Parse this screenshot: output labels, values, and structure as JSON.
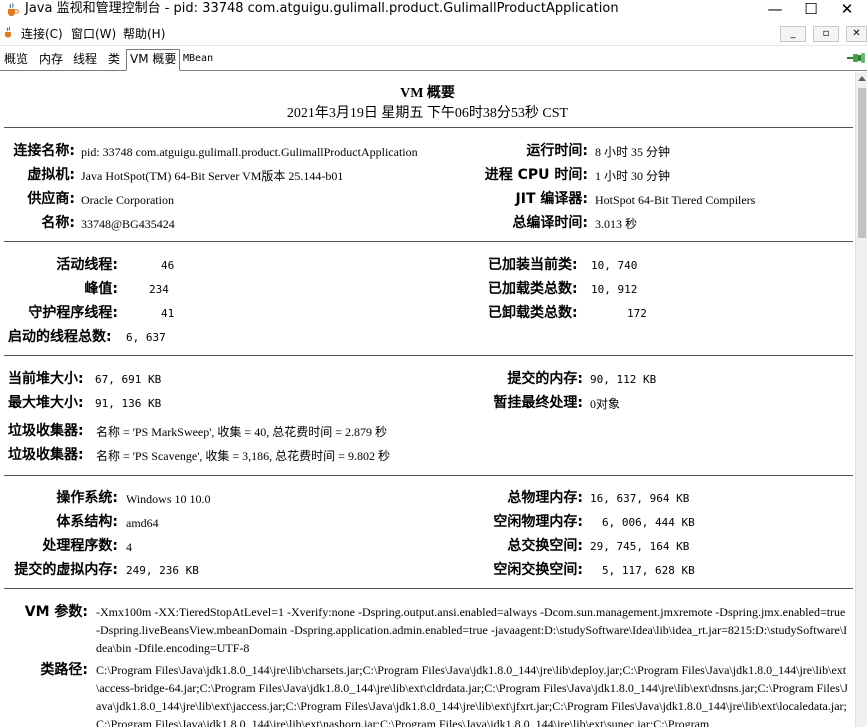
{
  "window": {
    "title": "Java 监视和管理控制台 - pid: 33748 com.atguigu.gulimall.product.GulimallProductApplication",
    "minimize": "—",
    "maximize": "☐",
    "close": "✕"
  },
  "menu": {
    "items": [
      "连接(C)",
      "窗口(W)",
      "帮助(H)"
    ],
    "mdi_buttons": [
      "_",
      "▫",
      "✕"
    ]
  },
  "tabs": [
    "概览",
    "内存",
    "线程",
    "类",
    "VM 概要",
    "MBean"
  ],
  "vm": {
    "title": "VM 概要",
    "datetime": "2021年3月19日 星期五 下午06时38分53秒 CST",
    "section1": {
      "rows_left": [
        {
          "label": "连接名称:",
          "value": "pid: 33748 com.atguigu.gulimall.product.GulimallProductApplication"
        },
        {
          "label": "虚拟机:",
          "value": "Java HotSpot(TM) 64-Bit Server VM版本 25.144-b01"
        },
        {
          "label": "供应商:",
          "value": "Oracle Corporation"
        },
        {
          "label": "名称:",
          "value": "33748@BG435424"
        }
      ],
      "rows_right": [
        {
          "label": "运行时间:",
          "value": "8 小时 35 分钟"
        },
        {
          "label": "进程 CPU 时间:",
          "value": "1 小时 30 分钟"
        },
        {
          "label": "JIT 编译器:",
          "value": "HotSpot 64-Bit Tiered Compilers"
        },
        {
          "label": "总编译时间:",
          "value": "3.013 秒"
        }
      ]
    },
    "section2": {
      "rows_left": [
        {
          "label": "活动线程:",
          "value": "46"
        },
        {
          "label": "峰值:",
          "value": "234"
        },
        {
          "label": "守护程序线程:",
          "value": "41"
        },
        {
          "label": "启动的线程总数:",
          "value": "6, 637"
        }
      ],
      "rows_right": [
        {
          "label": "已加装当前类:",
          "value": "10, 740"
        },
        {
          "label": "已加载类总数:",
          "value": "10, 912"
        },
        {
          "label": "已卸载类总数:",
          "value": "172"
        }
      ]
    },
    "section3": {
      "rows_left": [
        {
          "label": "当前堆大小:",
          "value": "67, 691 KB"
        },
        {
          "label": "最大堆大小:",
          "value": "91, 136 KB"
        }
      ],
      "rows_right": [
        {
          "label": "提交的内存:",
          "value": "90, 112 KB"
        },
        {
          "label": "暂挂最终处理:",
          "value": "0对象"
        }
      ],
      "gc": [
        {
          "label": "垃圾收集器:",
          "value": "名称 = 'PS MarkSweep', 收集 = 40, 总花费时间 = 2.879 秒"
        },
        {
          "label": "垃圾收集器:",
          "value": "名称 = 'PS Scavenge', 收集 = 3,186, 总花费时间 = 9.802 秒"
        }
      ]
    },
    "section4": {
      "rows_left": [
        {
          "label": "操作系统:",
          "value": "Windows 10 10.0"
        },
        {
          "label": "体系结构:",
          "value": "amd64"
        },
        {
          "label": "处理程序数:",
          "value": "4"
        },
        {
          "label": "提交的虚拟内存:",
          "value": "249, 236 KB"
        }
      ],
      "rows_right": [
        {
          "label": "总物理内存:",
          "value": "16, 637, 964 KB"
        },
        {
          "label": "空闲物理内存:",
          "value": "6, 006, 444 KB"
        },
        {
          "label": "总交换空间:",
          "value": "29, 745, 164 KB"
        },
        {
          "label": "空闲交换空间:",
          "value": "5, 117, 628 KB"
        }
      ]
    },
    "section5": {
      "vm_args_label": "VM 参数:",
      "vm_args": "-Xmx100m -XX:TieredStopAtLevel=1 -Xverify:none -Dspring.output.ansi.enabled=always -Dcom.sun.management.jmxremote -Dspring.jmx.enabled=true -Dspring.liveBeansView.mbeanDomain -Dspring.application.admin.enabled=true -javaagent:D:\\studySoftware\\Idea\\lib\\idea_rt.jar=8215:D:\\studySoftware\\Idea\\bin -Dfile.encoding=UTF-8",
      "classpath_label": "类路径:",
      "classpath": "C:\\Program Files\\Java\\jdk1.8.0_144\\jre\\lib\\charsets.jar;C:\\Program Files\\Java\\jdk1.8.0_144\\jre\\lib\\deploy.jar;C:\\Program Files\\Java\\jdk1.8.0_144\\jre\\lib\\ext\\access-bridge-64.jar;C:\\Program Files\\Java\\jdk1.8.0_144\\jre\\lib\\ext\\cldrdata.jar;C:\\Program Files\\Java\\jdk1.8.0_144\\jre\\lib\\ext\\dnsns.jar;C:\\Program Files\\Java\\jdk1.8.0_144\\jre\\lib\\ext\\jaccess.jar;C:\\Program Files\\Java\\jdk1.8.0_144\\jre\\lib\\ext\\jfxrt.jar;C:\\Program Files\\Java\\jdk1.8.0_144\\jre\\lib\\ext\\localedata.jar;C:\\Program Files\\Java\\jdk1.8.0_144\\jre\\lib\\ext\\nashorn.jar;C:\\Program Files\\Java\\jdk1.8.0_144\\jre\\lib\\ext\\sunec.jar;C:\\Program"
    }
  },
  "colors": {
    "accent_icon": "#2e7d32",
    "rule_line": "#555555"
  }
}
